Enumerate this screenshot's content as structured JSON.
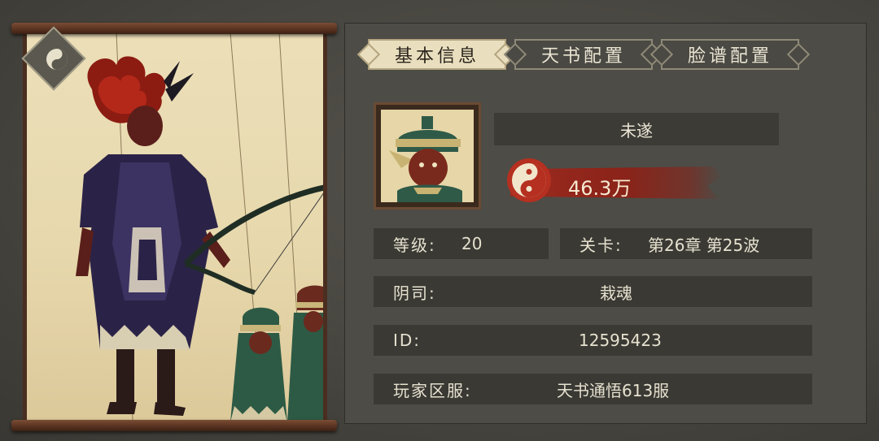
{
  "tabs": [
    {
      "label": "基本信息",
      "active": true
    },
    {
      "label": "天书配置",
      "active": false
    },
    {
      "label": "脸谱配置",
      "active": false
    }
  ],
  "character": {
    "name": "未遂",
    "power": "46.3万"
  },
  "info": {
    "level_label": "等级:",
    "level_value": "20",
    "stage_label": "关卡:",
    "stage_value": "第26章 第25波",
    "yinsi_label": "阴司:",
    "yinsi_value": "栽魂",
    "id_label": "ID:",
    "id_value": "12595423",
    "server_label": "玩家区服:",
    "server_value": "天书通悟613服"
  },
  "colors": {
    "panel": "#4d4c46",
    "row": "#3a3934",
    "tab_active": "#e9dfbf",
    "power_red": "#9c2a1f",
    "scroll_paper": "#e7d8ad",
    "scroll_wood": "#5a3321"
  },
  "icons": {
    "badge": "yin-yang-icon",
    "power": "yin-yang-swirl-icon"
  }
}
